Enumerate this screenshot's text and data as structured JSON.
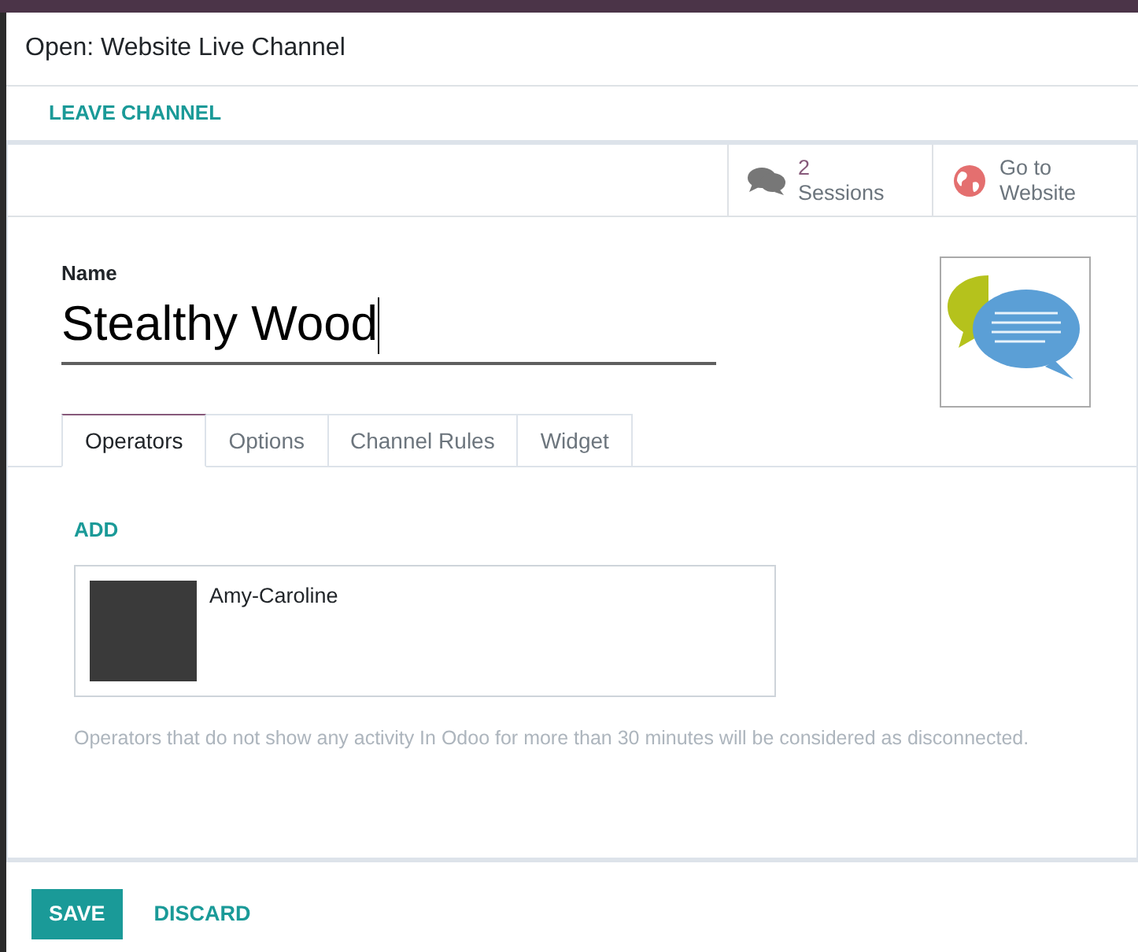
{
  "dialog": {
    "title": "Open: Website Live Channel"
  },
  "header_buttons": [
    "LEAVE CHANNEL"
  ],
  "smart_buttons": [
    {
      "kind": "sessions",
      "value": "2",
      "label": "Sessions"
    },
    {
      "kind": "website",
      "value": "Go to",
      "label": "Website"
    }
  ],
  "form": {
    "name_label": "Name",
    "name_value": "Stealthy Wood"
  },
  "tabs": [
    {
      "label": "Operators",
      "selected": true
    },
    {
      "label": "Options",
      "selected": false
    },
    {
      "label": "Channel Rules",
      "selected": false
    },
    {
      "label": "Widget",
      "selected": false
    }
  ],
  "operators": {
    "add_label": "ADD",
    "items": [
      {
        "name": "Amy-Caroline"
      }
    ],
    "help": "Operators that do not show any activity In Odoo for more than 30 minutes will be considered as disconnected."
  },
  "footer_buttons": [
    {
      "label": "SAVE",
      "kind": "primary"
    },
    {
      "label": "DISCARD",
      "kind": "link"
    }
  ]
}
